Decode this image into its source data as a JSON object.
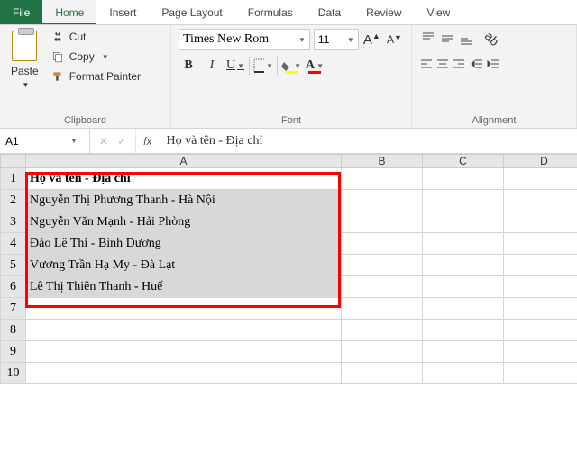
{
  "tabs": {
    "file": "File",
    "home": "Home",
    "insert": "Insert",
    "pagelayout": "Page Layout",
    "formulas": "Formulas",
    "data": "Data",
    "review": "Review",
    "view": "View"
  },
  "clipboard": {
    "paste": "Paste",
    "cut": "Cut",
    "copy": "Copy",
    "formatpainter": "Format Painter",
    "group": "Clipboard"
  },
  "font": {
    "name": "Times New Rom",
    "size": "11",
    "group": "Font",
    "increase": "A",
    "decrease": "A",
    "bold": "B",
    "italic": "I",
    "underline": "U",
    "fill_color": "#ffff00",
    "font_color": "#ff0000"
  },
  "alignment": {
    "group": "Alignment"
  },
  "namebox": "A1",
  "formula_bar_value": "Họ và tên - Địa chỉ",
  "columns": [
    "A",
    "B",
    "C",
    "D"
  ],
  "rows": [
    {
      "n": 1,
      "a": "Họ và tên - Địa chỉ",
      "bold": true,
      "selected": true
    },
    {
      "n": 2,
      "a": "Nguyễn Thị Phương Thanh - Hà Nội",
      "selected": true
    },
    {
      "n": 3,
      "a": "Nguyễn Văn Mạnh - Hải Phòng",
      "selected": true
    },
    {
      "n": 4,
      "a": "Đào Lê Thi - Bình Dương",
      "selected": true
    },
    {
      "n": 5,
      "a": "Vương Trần Hạ My - Đà Lạt",
      "selected": true
    },
    {
      "n": 6,
      "a": "Lê Thị Thiên Thanh - Huế",
      "selected": true
    },
    {
      "n": 7,
      "a": ""
    },
    {
      "n": 8,
      "a": ""
    },
    {
      "n": 9,
      "a": ""
    },
    {
      "n": 10,
      "a": ""
    }
  ]
}
